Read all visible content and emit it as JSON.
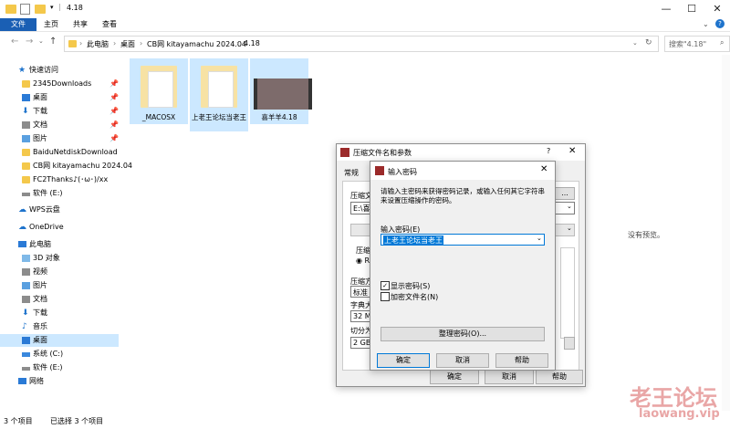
{
  "window": {
    "title": "4.18",
    "close": "✕",
    "minimize": "—",
    "maximize": "☐"
  },
  "ribbon": {
    "tabs": [
      "文件",
      "主页",
      "共享",
      "查看"
    ]
  },
  "address": {
    "crumbs": [
      "此电脑",
      "桌面",
      "CB网 kitayamachu 2024.04",
      "4.18"
    ],
    "search_placeholder": "搜索\"4.18\""
  },
  "sidebar": {
    "quick_access": "快速访问",
    "pinned": [
      "2345Downloads",
      "桌面",
      "下载",
      "文档",
      "图片"
    ],
    "folders": [
      "BaiduNetdiskDownload",
      "CB网 kitayamachu 2024.04",
      "FC2Thanks♪(･ω･)/xx"
    ],
    "drive_e1": "软件 (E:)",
    "wps": "WPS云盘",
    "onedrive": "OneDrive",
    "this_pc": "此电脑",
    "pc_items": [
      "3D 对象",
      "视频",
      "图片",
      "文档",
      "下载",
      "音乐",
      "桌面",
      "系统 (C:)",
      "软件 (E:)"
    ],
    "network": "网络"
  },
  "files": [
    "_MACOSX",
    "上老王论坛当老王",
    "喜羊羊4.18"
  ],
  "status": {
    "count": "3 个项目",
    "selected": "已选择 3 个项目"
  },
  "preview_text": "没有预览。",
  "archive_dialog": {
    "title": "压缩文件名和参数",
    "help": "?",
    "tab": "常规",
    "labels": [
      "压缩文",
      "E:\\喜羊",
      "压缩",
      "RA",
      "压缩方",
      "标准",
      "字典大",
      "32 MB",
      "切分为",
      "2 GB"
    ],
    "buttons": {
      "ok": "确定",
      "cancel": "取消",
      "help": "帮助"
    }
  },
  "password_dialog": {
    "title": "输入密码",
    "close": "✕",
    "description": "请输入主密码来获得密码记录，或输入任何其它字符串来设置压缩操作的密码。",
    "input_label": "输入密码(E)",
    "password_value": "上老王论坛当老王",
    "show_password": "显示密码(S)",
    "encrypt_names": "加密文件名(N)",
    "organize": "整理密码(O)...",
    "ok": "确定",
    "cancel": "取消",
    "help": "帮助"
  },
  "watermark": {
    "text": "老王论坛",
    "url": "laowang.vip"
  }
}
